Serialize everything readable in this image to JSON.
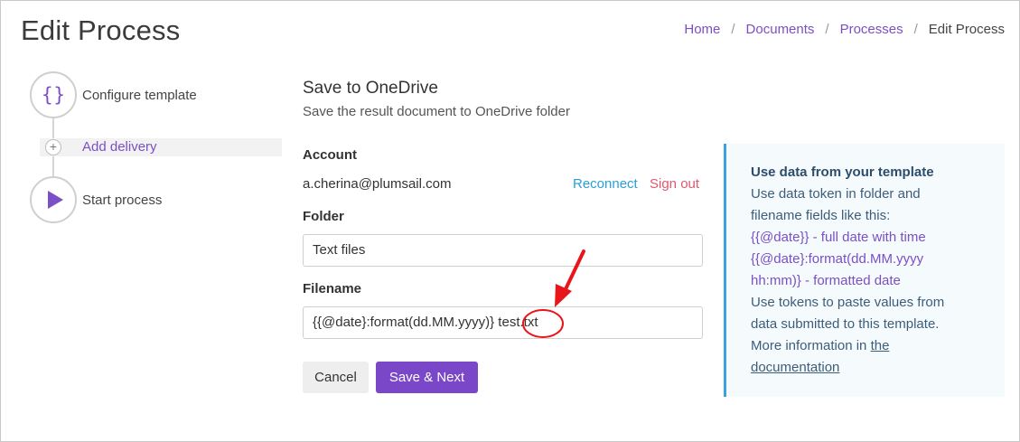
{
  "page": {
    "title": "Edit Process"
  },
  "breadcrumb": {
    "home": "Home",
    "documents": "Documents",
    "processes": "Processes",
    "current": "Edit Process",
    "separator": "/"
  },
  "steps": {
    "configure": {
      "label": "Configure template",
      "icon": "{}"
    },
    "add": {
      "label": "Add delivery",
      "icon": "+"
    },
    "start": {
      "label": "Start process"
    }
  },
  "section": {
    "title": "Save to OneDrive",
    "subtitle": "Save the result document to OneDrive folder"
  },
  "account": {
    "label": "Account",
    "email": "a.cherina@plumsail.com",
    "reconnect": "Reconnect",
    "signout": "Sign out"
  },
  "folder": {
    "label": "Folder",
    "value": "Text files"
  },
  "filename": {
    "label": "Filename",
    "value": "{{@date}:format(dd.MM.yyyy)} test.txt"
  },
  "buttons": {
    "cancel": "Cancel",
    "save": "Save & Next"
  },
  "info": {
    "title": "Use data from your template",
    "line1": "Use data token in folder and",
    "line2": "filename fields like this:",
    "tok1": "{{@date}} - full date with time",
    "tok2a": "{{@date}:format(dd.MM.yyyy",
    "tok2b": "hh:mm)} - formatted date",
    "line3": "Use tokens to paste values from",
    "line4": "data submitted to this template.",
    "line5": "More information in ",
    "link1": "the",
    "link2": "documentation"
  },
  "colors": {
    "accent": "#7b47c9",
    "link": "#2a9fd6",
    "danger": "#e05a6e",
    "annotation": "#e8161b",
    "info_border": "#3aa3df"
  }
}
